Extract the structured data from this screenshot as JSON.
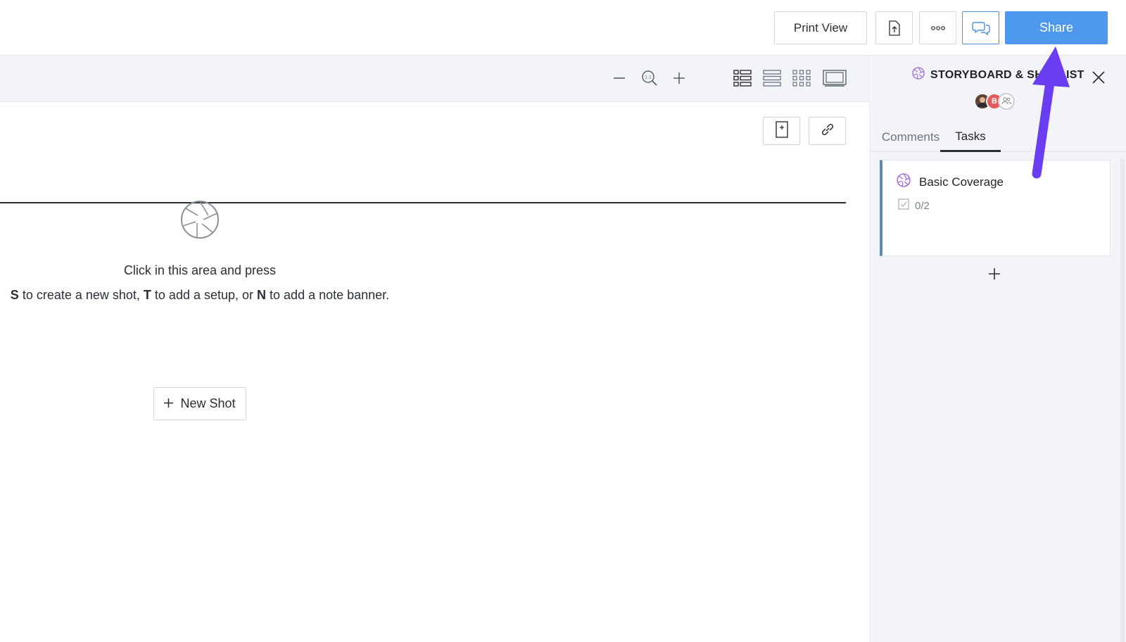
{
  "topbar": {
    "print_label": "Print View",
    "export_icon": "export-file-icon",
    "more_icon": "more-options-icon",
    "comments_icon": "comments-icon",
    "share_label": "Share"
  },
  "toolbar": {
    "zoom_out_icon": "minus-icon",
    "zoom_reset_icon": "zoom-reset-icon",
    "zoom_in_icon": "plus-icon",
    "views": [
      "list-view-icon",
      "rows-view-icon",
      "grid-view-icon",
      "filmstrip-view-icon"
    ]
  },
  "header": {
    "button_1_icon": "insert-page-icon",
    "button_2_icon": "link-icon"
  },
  "empty_state": {
    "icon": "aperture-icon",
    "line1": "Click in this area and press",
    "line2_parts": [
      {
        "text": "S",
        "bold": true
      },
      {
        "text": " to create a new shot, ",
        "bold": false
      },
      {
        "text": "T",
        "bold": true
      },
      {
        "text": " to add a setup, or ",
        "bold": false
      },
      {
        "text": "N",
        "bold": true
      },
      {
        "text": " to add a note banner.",
        "bold": false
      }
    ],
    "new_shot_label": "New Shot"
  },
  "panel": {
    "title": "STORYBOARD & SHOTLIST",
    "title_icon": "aperture-icon",
    "close_icon": "close-icon",
    "avatars": [
      {
        "type": "photo",
        "initial": ""
      },
      {
        "type": "initial",
        "initial": "B"
      },
      {
        "type": "group",
        "initial": ""
      }
    ],
    "tabs": [
      {
        "label": "Comments",
        "active": false
      },
      {
        "label": "Tasks",
        "active": true
      }
    ],
    "task": {
      "title": "Basic Coverage",
      "progress": "0/2"
    },
    "add_icon": "plus-icon"
  },
  "colors": {
    "accent": "#4d97ec",
    "annotation_arrow": "#6a3df0",
    "aperture_purple": "#9b6bd6"
  }
}
